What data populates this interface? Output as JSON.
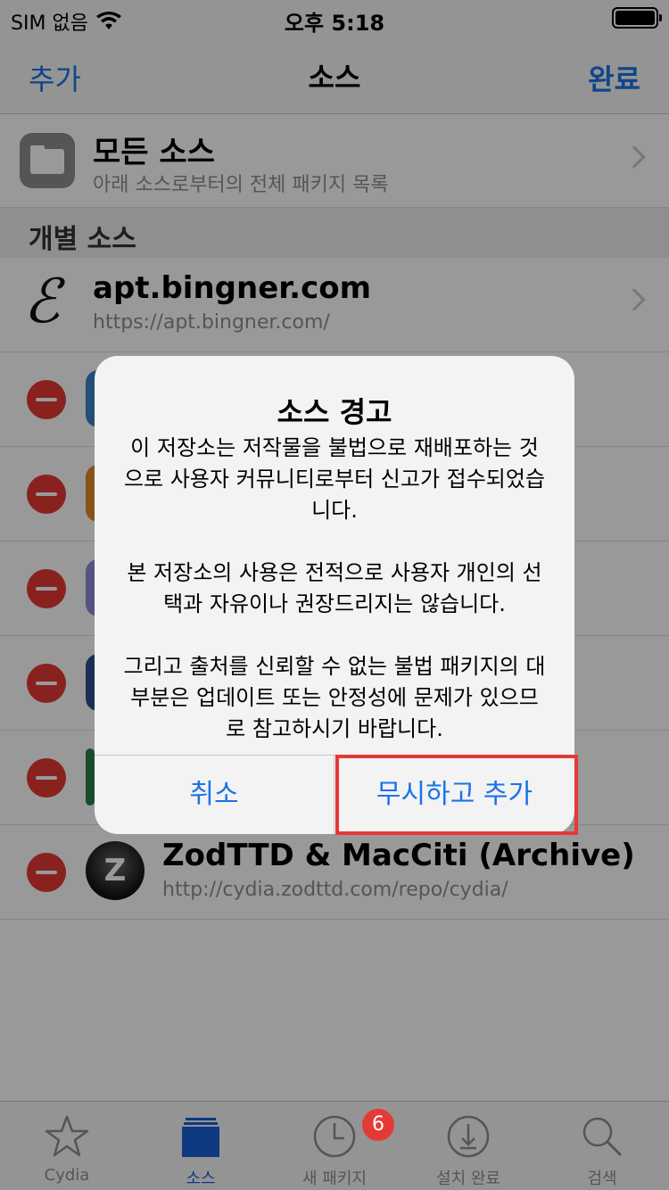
{
  "status_bar": {
    "carrier": "SIM 없음",
    "time": "오후 5:18"
  },
  "nav": {
    "left": "추가",
    "title": "소스",
    "right": "완료"
  },
  "all_sources": {
    "title": "모든 소스",
    "subtitle": "아래 소스로부터의 전체 패키지 목록"
  },
  "section_header": "개별 소스",
  "first_source": {
    "title": "apt.bingner.com",
    "url": "https://apt.bingner.com/"
  },
  "last_source": {
    "title": "ZodTTD & MacCiti (Archive)",
    "url": "http://cydia.zodttd.com/repo/cydia/",
    "icon_letter": "Z"
  },
  "alert": {
    "title": "소스 경고",
    "message": "이 저장소는 저작물을 불법으로 재배포하는 것으로 사용자 커뮤니티로부터 신고가 접수되었습니다.\n\n본 저장소의 사용은 전적으로 사용자 개인의 선택과 자유이나 권장드리지는 않습니다.\n\n그리고 출처를 신뢰할 수 없는 불법 패키지의 대부분은 업데이트 또는 안정성에 문제가 있으므로 참고하시기 바랍니다.",
    "cancel": "취소",
    "confirm": "무시하고 추가"
  },
  "tabs": [
    {
      "label": "Cydia",
      "icon": "star-icon"
    },
    {
      "label": "소스",
      "icon": "sources-icon"
    },
    {
      "label": "새 패키지",
      "icon": "clock-icon",
      "badge": "6"
    },
    {
      "label": "설치 완료",
      "icon": "download-icon"
    },
    {
      "label": "검색",
      "icon": "search-icon"
    }
  ],
  "colors": {
    "accent": "#1a73e8",
    "delete": "#e53935",
    "highlight": "#e53935"
  }
}
